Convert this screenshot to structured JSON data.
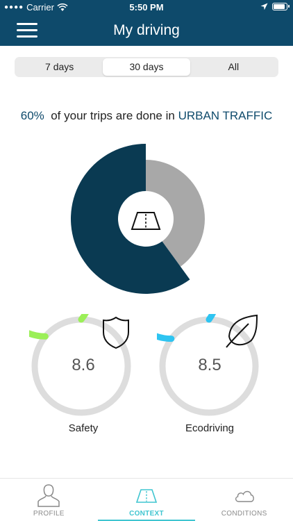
{
  "status_bar": {
    "carrier": "Carrier",
    "time": "5:50 PM",
    "wifi_icon": "wifi-icon",
    "location_icon": "location-arrow-icon",
    "battery_icon": "battery-icon"
  },
  "header": {
    "title": "My driving",
    "menu_icon": "hamburger-menu-icon"
  },
  "period_selector": {
    "options": [
      "7 days",
      "30 days",
      "All"
    ],
    "selected": "30 days"
  },
  "summary": {
    "percent": "60%",
    "text": "of your trips are done in",
    "context": "URBAN TRAFFIC"
  },
  "donut": {
    "urban_fraction": 0.6,
    "other_fraction": 0.4,
    "urban_color": "#0a3a52",
    "other_color": "#a8a8a8",
    "center_icon": "road-icon"
  },
  "scores": [
    {
      "label": "Safety",
      "value": "8.6",
      "fraction": 0.86,
      "color": "#9bef58",
      "track": "#dddddd",
      "icon": "shield-icon"
    },
    {
      "label": "Ecodriving",
      "value": "8.5",
      "fraction": 0.85,
      "color": "#2ec4f1",
      "track": "#dddddd",
      "icon": "leaf-icon"
    }
  ],
  "tabs": [
    {
      "label": "PROFILE",
      "icon": "person-icon"
    },
    {
      "label": "CONTEXT",
      "icon": "road-icon",
      "active": true
    },
    {
      "label": "CONDITIONS",
      "icon": "cloud-icon"
    }
  ],
  "colors": {
    "primary": "#0e4a6b",
    "accent": "#3fc5d0"
  }
}
